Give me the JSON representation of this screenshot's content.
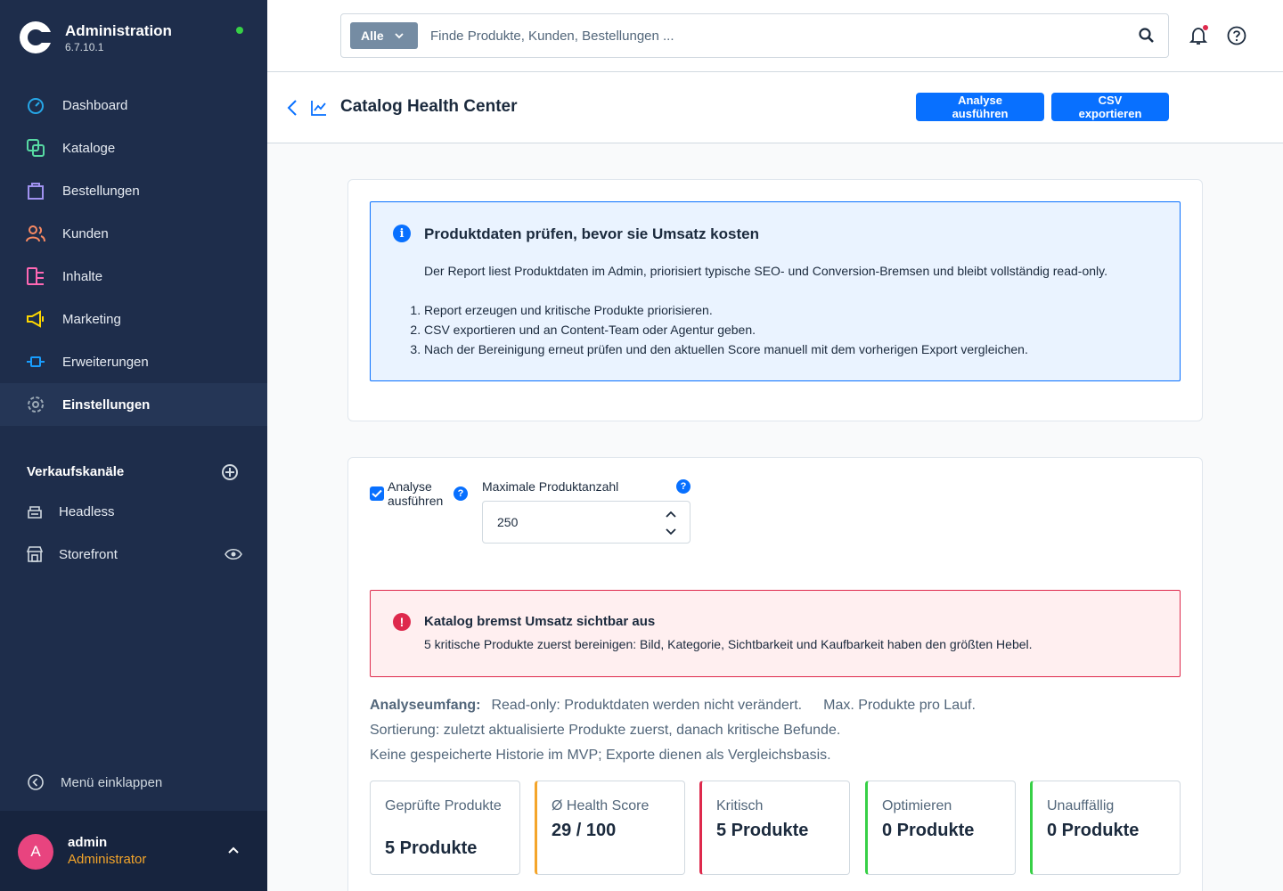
{
  "app": {
    "title": "Administration",
    "version": "6.7.10.1",
    "status_color": "#37d046"
  },
  "nav": {
    "items": [
      {
        "label": "Dashboard",
        "icon": "dashboard-icon",
        "color": "#26a7e8"
      },
      {
        "label": "Kataloge",
        "icon": "catalog-icon",
        "color": "#57d9a3"
      },
      {
        "label": "Bestellungen",
        "icon": "shopping-bag-icon",
        "color": "#a092f0"
      },
      {
        "label": "Kunden",
        "icon": "users-icon",
        "color": "#f88962"
      },
      {
        "label": "Inhalte",
        "icon": "content-icon",
        "color": "#ff68b4"
      },
      {
        "label": "Marketing",
        "icon": "megaphone-icon",
        "color": "#ffd700"
      },
      {
        "label": "Erweiterungen",
        "icon": "plug-icon",
        "color": "#189eff"
      },
      {
        "label": "Einstellungen",
        "icon": "gear-icon",
        "color": "#9aa8b5"
      }
    ],
    "active_index": 7
  },
  "sales_channels": {
    "title": "Verkaufskanäle",
    "items": [
      {
        "label": "Headless",
        "icon": "headless-icon"
      },
      {
        "label": "Storefront",
        "icon": "storefront-icon"
      }
    ]
  },
  "collapse_label": "Menü einklappen",
  "user": {
    "initial": "A",
    "name": "admin",
    "role": "Administrator"
  },
  "search": {
    "type_label": "Alle",
    "placeholder": "Finde Produkte, Kunden, Bestellungen ..."
  },
  "page": {
    "title": "Catalog Health Center",
    "run_button": "Analyse ausführen",
    "export_button": "CSV exportieren"
  },
  "info": {
    "title": "Produktdaten prüfen, bevor sie Umsatz kosten",
    "text": "Der Report liest Produktdaten im Admin, priorisiert typische SEO- und Conversion-Bremsen und bleibt vollständig read-only.",
    "steps": [
      "Report erzeugen und kritische Produkte priorisieren.",
      "CSV exportieren und an Content-Team oder Agentur geben.",
      "Nach der Bereinigung erneut prüfen und den aktuellen Score manuell mit dem vorherigen Export vergleichen."
    ]
  },
  "form": {
    "run_checkbox_label": "Analyse ausführen",
    "run_checked": true,
    "max_label": "Maximale Produktanzahl",
    "max_value": "250"
  },
  "alert": {
    "title": "Katalog bremst Umsatz sichtbar aus",
    "text": "5 kritische Produkte zuerst bereinigen: Bild, Kategorie, Sichtbarkeit und Kaufbarkeit haben den größten Hebel."
  },
  "scope": {
    "label": "Analyseumfang:",
    "item1": "Read-only: Produktdaten werden nicht verändert.",
    "item2": "Max. Produkte pro Lauf.",
    "line2": "Sortierung: zuletzt aktualisierte Produkte zuerst, danach kritische Befunde.",
    "line3": "Keine gespeicherte Historie im MVP; Exporte dienen als Vergleichsbasis."
  },
  "kpis": [
    {
      "label": "Geprüfte Produkte",
      "value": "5 Produkte",
      "accent": ""
    },
    {
      "label": "Ø Health Score",
      "value": "29 / 100",
      "accent": "#f4a52a"
    },
    {
      "label": "Kritisch",
      "value": "5 Produkte",
      "accent": "#de294c"
    },
    {
      "label": "Optimieren",
      "value": "0 Produkte",
      "accent": "#37d046"
    },
    {
      "label": "Unauffällig",
      "value": "0 Produkte",
      "accent": "#37d046"
    }
  ]
}
